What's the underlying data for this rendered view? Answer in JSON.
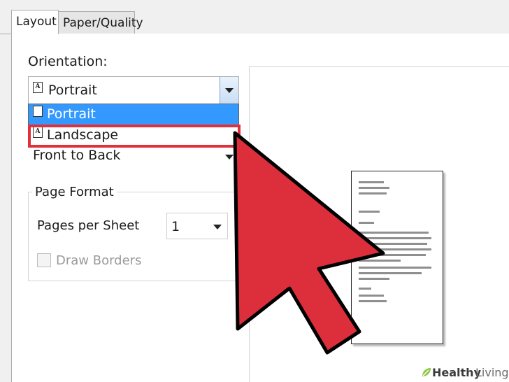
{
  "tabs": [
    {
      "label": "Layout",
      "active": true
    },
    {
      "label": "Paper/Quality",
      "active": false
    }
  ],
  "orientation": {
    "label": "Orientation:",
    "selected": "Portrait",
    "options": [
      "Portrait",
      "Landscape"
    ],
    "highlighted_option": "Landscape"
  },
  "page_order": {
    "value": "Front to Back"
  },
  "page_format": {
    "title": "Page Format",
    "pages_per_sheet_label": "Pages per Sheet",
    "pages_per_sheet_value": "1",
    "draw_borders_label": "Draw Borders",
    "draw_borders_checked": false
  },
  "icons": {
    "document": "A",
    "arrow_color": "#dc2f3b"
  },
  "watermark": {
    "part1": "Healthy",
    "part2": "Living"
  }
}
